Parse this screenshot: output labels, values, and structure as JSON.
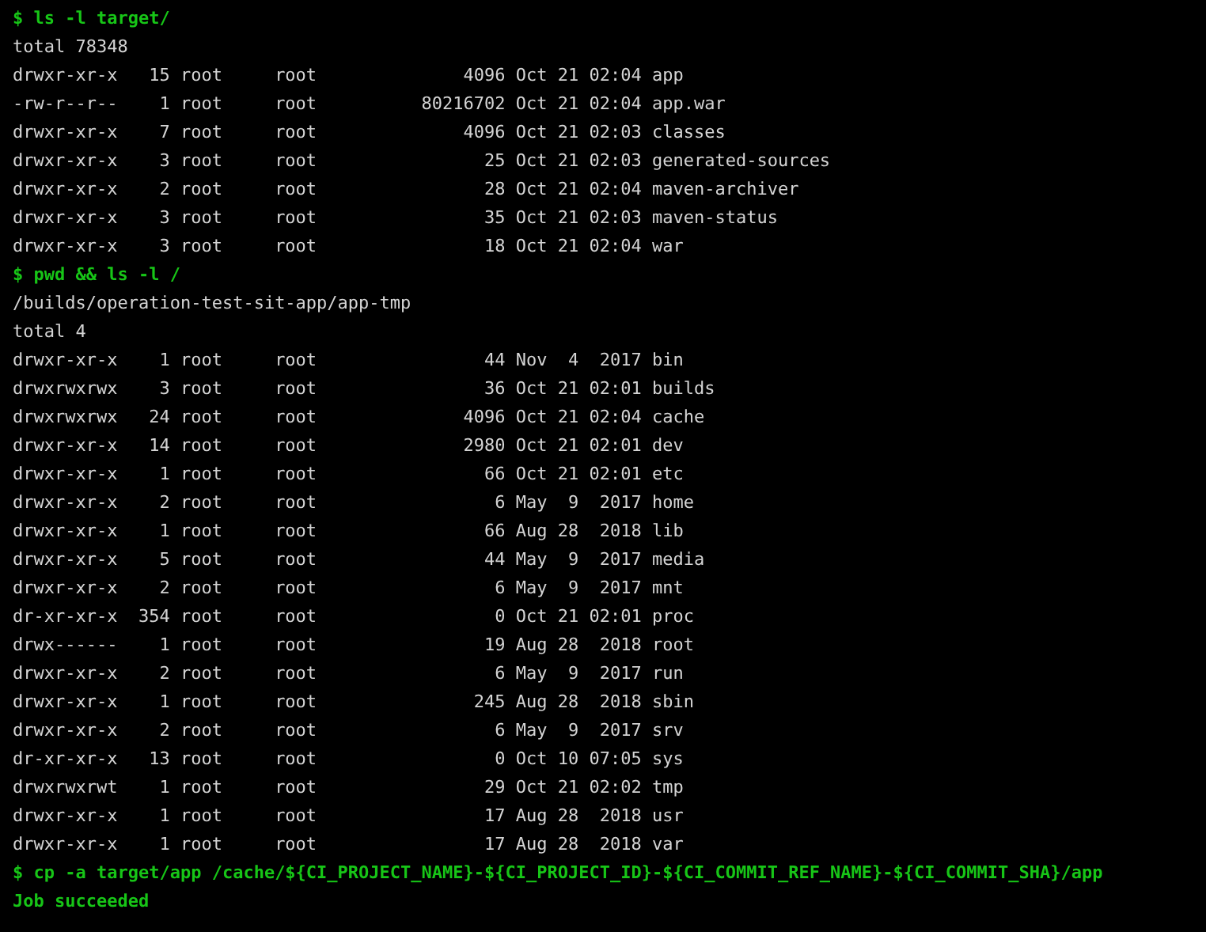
{
  "terminal": {
    "lines": [
      {
        "kind": "command",
        "text": "$ ls -l target/"
      },
      {
        "kind": "output",
        "text": "total 78348"
      },
      {
        "kind": "output",
        "text": "drwxr-xr-x   15 root     root              4096 Oct 21 02:04 app"
      },
      {
        "kind": "output",
        "text": "-rw-r--r--    1 root     root          80216702 Oct 21 02:04 app.war"
      },
      {
        "kind": "output",
        "text": "drwxr-xr-x    7 root     root              4096 Oct 21 02:03 classes"
      },
      {
        "kind": "output",
        "text": "drwxr-xr-x    3 root     root                25 Oct 21 02:03 generated-sources"
      },
      {
        "kind": "output",
        "text": "drwxr-xr-x    2 root     root                28 Oct 21 02:04 maven-archiver"
      },
      {
        "kind": "output",
        "text": "drwxr-xr-x    3 root     root                35 Oct 21 02:03 maven-status"
      },
      {
        "kind": "output",
        "text": "drwxr-xr-x    3 root     root                18 Oct 21 02:04 war"
      },
      {
        "kind": "command",
        "text": "$ pwd && ls -l /"
      },
      {
        "kind": "output",
        "text": "/builds/operation-test-sit-app/app-tmp"
      },
      {
        "kind": "output",
        "text": "total 4"
      },
      {
        "kind": "output",
        "text": "drwxr-xr-x    1 root     root                44 Nov  4  2017 bin"
      },
      {
        "kind": "output",
        "text": "drwxrwxrwx    3 root     root                36 Oct 21 02:01 builds"
      },
      {
        "kind": "output",
        "text": "drwxrwxrwx   24 root     root              4096 Oct 21 02:04 cache"
      },
      {
        "kind": "output",
        "text": "drwxr-xr-x   14 root     root              2980 Oct 21 02:01 dev"
      },
      {
        "kind": "output",
        "text": "drwxr-xr-x    1 root     root                66 Oct 21 02:01 etc"
      },
      {
        "kind": "output",
        "text": "drwxr-xr-x    2 root     root                 6 May  9  2017 home"
      },
      {
        "kind": "output",
        "text": "drwxr-xr-x    1 root     root                66 Aug 28  2018 lib"
      },
      {
        "kind": "output",
        "text": "drwxr-xr-x    5 root     root                44 May  9  2017 media"
      },
      {
        "kind": "output",
        "text": "drwxr-xr-x    2 root     root                 6 May  9  2017 mnt"
      },
      {
        "kind": "output",
        "text": "dr-xr-xr-x  354 root     root                 0 Oct 21 02:01 proc"
      },
      {
        "kind": "output",
        "text": "drwx------    1 root     root                19 Aug 28  2018 root"
      },
      {
        "kind": "output",
        "text": "drwxr-xr-x    2 root     root                 6 May  9  2017 run"
      },
      {
        "kind": "output",
        "text": "drwxr-xr-x    1 root     root               245 Aug 28  2018 sbin"
      },
      {
        "kind": "output",
        "text": "drwxr-xr-x    2 root     root                 6 May  9  2017 srv"
      },
      {
        "kind": "output",
        "text": "dr-xr-xr-x   13 root     root                 0 Oct 10 07:05 sys"
      },
      {
        "kind": "output",
        "text": "drwxrwxrwt    1 root     root                29 Oct 21 02:02 tmp"
      },
      {
        "kind": "output",
        "text": "drwxr-xr-x    1 root     root                17 Aug 28  2018 usr"
      },
      {
        "kind": "output",
        "text": "drwxr-xr-x    1 root     root                17 Aug 28  2018 var"
      },
      {
        "kind": "command",
        "text": "$ cp -a target/app /cache/${CI_PROJECT_NAME}-${CI_PROJECT_ID}-${CI_COMMIT_REF_NAME}-${CI_COMMIT_SHA}/app"
      },
      {
        "kind": "status",
        "text": "Job succeeded"
      }
    ]
  }
}
